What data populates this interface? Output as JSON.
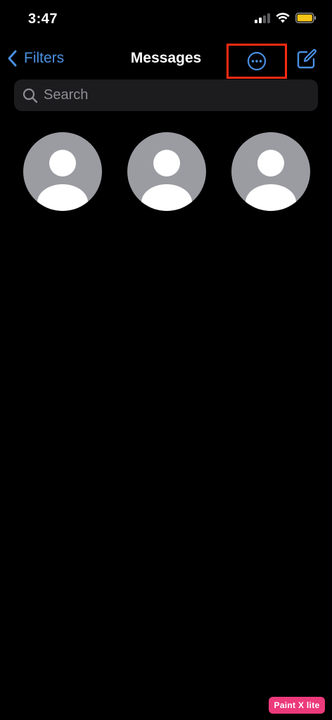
{
  "status_bar": {
    "time": "3:47",
    "icons": [
      "cellular-signal-icon",
      "wifi-icon",
      "battery-icon"
    ],
    "battery_color": "#f5c518"
  },
  "nav": {
    "back_label": "Filters",
    "title": "Messages",
    "more_icon": "ellipsis-circle-icon",
    "compose_icon": "compose-icon",
    "highlight_color": "#ff2a12",
    "accent_color": "#4a90e2"
  },
  "search": {
    "placeholder": "Search",
    "value": ""
  },
  "pinned_contacts": [
    {
      "icon": "person-icon"
    },
    {
      "icon": "person-icon"
    },
    {
      "icon": "person-icon"
    }
  ],
  "watermark": {
    "text": "Paint X lite"
  }
}
